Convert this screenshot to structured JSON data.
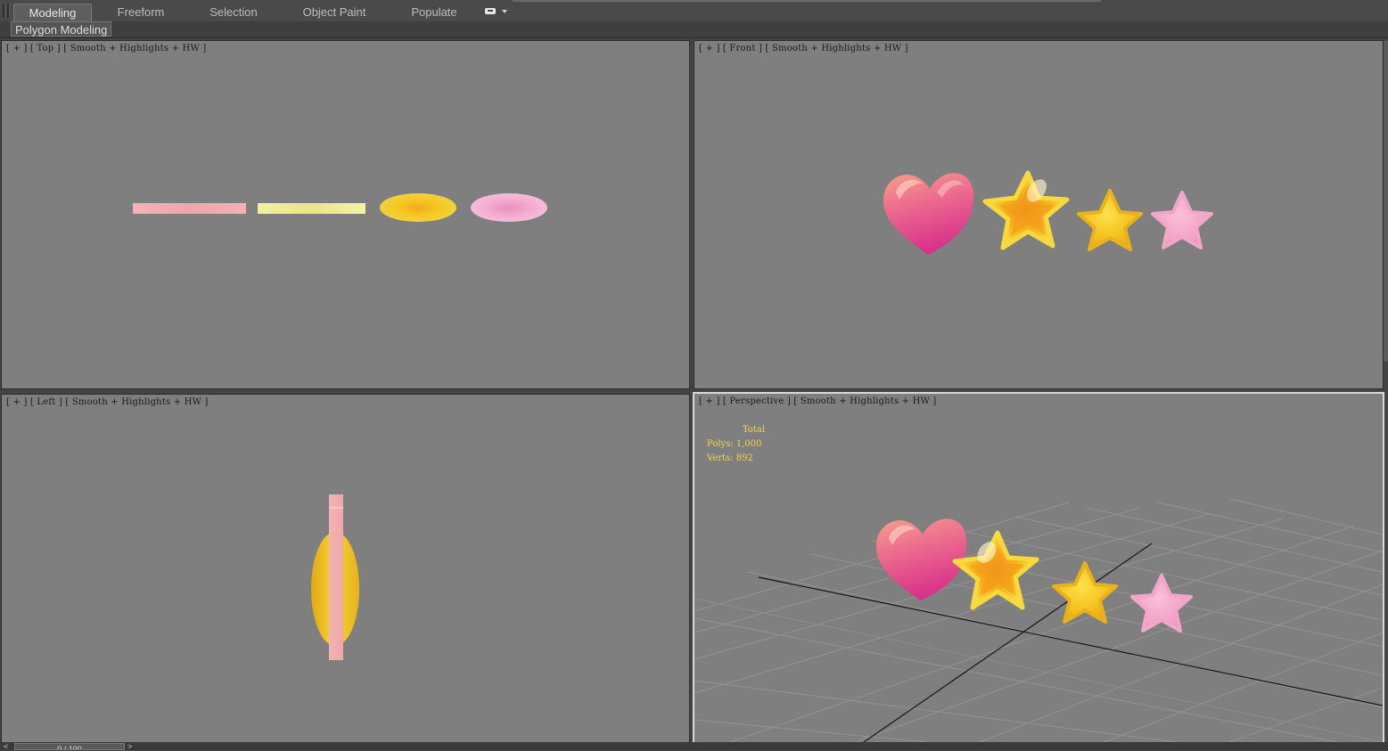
{
  "ribbon": {
    "tabs": [
      {
        "label": "Modeling",
        "active": true
      },
      {
        "label": "Freeform",
        "active": false
      },
      {
        "label": "Selection",
        "active": false
      },
      {
        "label": "Object Paint",
        "active": false
      },
      {
        "label": "Populate",
        "active": false
      }
    ],
    "panel_label": "Polygon Modeling"
  },
  "viewports": {
    "top": {
      "plus": "+",
      "view": "Top",
      "shading": "Smooth + Highlights + HW"
    },
    "front": {
      "plus": "+",
      "view": "Front",
      "shading": "Smooth + Highlights + HW"
    },
    "left": {
      "plus": "+",
      "view": "Left",
      "shading": "Smooth + Highlights + HW"
    },
    "perspective": {
      "plus": "+",
      "view": "Perspective",
      "shading": "Smooth + Highlights + HW"
    }
  },
  "stats": {
    "title": "Total",
    "polys": "Polys: 1,000",
    "verts": "Verts: 892"
  },
  "timeline": {
    "frame": "0 / 100",
    "left": "<",
    "right": ">"
  },
  "objects": [
    "heart",
    "star-large",
    "star-yellow",
    "star-pink"
  ],
  "colors": {
    "viewport_bg": "#7f7f7f",
    "heart_pink": "#e2508f",
    "star_yellow": "#f5c518",
    "star_pink": "#f4a2c4",
    "stats_yellow": "#f2d64a"
  }
}
